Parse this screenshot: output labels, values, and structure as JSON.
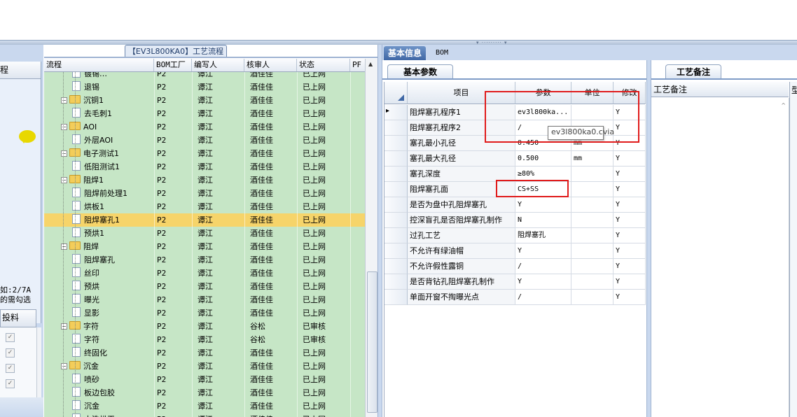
{
  "tree": {
    "title": "【EV3L800KA0】工艺流程",
    "columns": [
      "流程",
      "BOM工厂",
      "编写人",
      "核审人",
      "状态",
      "PF"
    ],
    "rows": [
      {
        "level": 2,
        "type": "doc",
        "name": "镀锡…",
        "bom": "P2",
        "writer": "谭江",
        "reviewer": "酒佳佳",
        "status": "已上网"
      },
      {
        "level": 2,
        "type": "doc",
        "name": "退锡",
        "bom": "P2",
        "writer": "谭江",
        "reviewer": "酒佳佳",
        "status": "已上网"
      },
      {
        "level": 1,
        "type": "folder",
        "name": "沉铜1",
        "bom": "P2",
        "writer": "谭江",
        "reviewer": "酒佳佳",
        "status": "已上网"
      },
      {
        "level": 2,
        "type": "doc",
        "name": "去毛刺1",
        "bom": "P2",
        "writer": "谭江",
        "reviewer": "酒佳佳",
        "status": "已上网"
      },
      {
        "level": 1,
        "type": "folder",
        "name": "AOI",
        "bom": "P2",
        "writer": "谭江",
        "reviewer": "酒佳佳",
        "status": "已上网"
      },
      {
        "level": 2,
        "type": "doc",
        "name": "外层AOI",
        "bom": "P2",
        "writer": "谭江",
        "reviewer": "酒佳佳",
        "status": "已上网"
      },
      {
        "level": 1,
        "type": "folder",
        "name": "电子测试1",
        "bom": "P2",
        "writer": "谭江",
        "reviewer": "酒佳佳",
        "status": "已上网"
      },
      {
        "level": 2,
        "type": "doc",
        "name": "低阻测试1",
        "bom": "P2",
        "writer": "谭江",
        "reviewer": "酒佳佳",
        "status": "已上网"
      },
      {
        "level": 1,
        "type": "folder",
        "name": "阻焊1",
        "bom": "P2",
        "writer": "谭江",
        "reviewer": "酒佳佳",
        "status": "已上网"
      },
      {
        "level": 2,
        "type": "doc",
        "name": "阻焊前处理1",
        "bom": "P2",
        "writer": "谭江",
        "reviewer": "酒佳佳",
        "status": "已上网"
      },
      {
        "level": 2,
        "type": "doc",
        "name": "烘板1",
        "bom": "P2",
        "writer": "谭江",
        "reviewer": "酒佳佳",
        "status": "已上网"
      },
      {
        "level": 2,
        "type": "doc",
        "name": "阻焊塞孔1",
        "bom": "P2",
        "writer": "谭江",
        "reviewer": "酒佳佳",
        "status": "已上网",
        "selected": true
      },
      {
        "level": 2,
        "type": "doc",
        "name": "预烘1",
        "bom": "P2",
        "writer": "谭江",
        "reviewer": "酒佳佳",
        "status": "已上网"
      },
      {
        "level": 1,
        "type": "folder",
        "name": "阻焊",
        "bom": "P2",
        "writer": "谭江",
        "reviewer": "酒佳佳",
        "status": "已上网"
      },
      {
        "level": 2,
        "type": "doc",
        "name": "阻焊塞孔",
        "bom": "P2",
        "writer": "谭江",
        "reviewer": "酒佳佳",
        "status": "已上网"
      },
      {
        "level": 2,
        "type": "doc",
        "name": "丝印",
        "bom": "P2",
        "writer": "谭江",
        "reviewer": "酒佳佳",
        "status": "已上网"
      },
      {
        "level": 2,
        "type": "doc",
        "name": "预烘",
        "bom": "P2",
        "writer": "谭江",
        "reviewer": "酒佳佳",
        "status": "已上网"
      },
      {
        "level": 2,
        "type": "doc",
        "name": "曝光",
        "bom": "P2",
        "writer": "谭江",
        "reviewer": "酒佳佳",
        "status": "已上网"
      },
      {
        "level": 2,
        "type": "doc",
        "name": "显影",
        "bom": "P2",
        "writer": "谭江",
        "reviewer": "酒佳佳",
        "status": "已上网"
      },
      {
        "level": 1,
        "type": "folder",
        "name": "字符",
        "bom": "P2",
        "writer": "谭江",
        "reviewer": "谷松",
        "status": "已审核"
      },
      {
        "level": 2,
        "type": "doc",
        "name": "字符",
        "bom": "P2",
        "writer": "谭江",
        "reviewer": "谷松",
        "status": "已审核"
      },
      {
        "level": 2,
        "type": "doc",
        "name": "终固化",
        "bom": "P2",
        "writer": "谭江",
        "reviewer": "酒佳佳",
        "status": "已上网"
      },
      {
        "level": 1,
        "type": "folder",
        "name": "沉金",
        "bom": "P2",
        "writer": "谭江",
        "reviewer": "酒佳佳",
        "status": "已上网"
      },
      {
        "level": 2,
        "type": "doc",
        "name": "喷砂",
        "bom": "P2",
        "writer": "谭江",
        "reviewer": "酒佳佳",
        "status": "已上网"
      },
      {
        "level": 2,
        "type": "doc",
        "name": "板边包胶",
        "bom": "P2",
        "writer": "谭江",
        "reviewer": "酒佳佳",
        "status": "已上网"
      },
      {
        "level": 2,
        "type": "doc",
        "name": "沉金",
        "bom": "P2",
        "writer": "谭江",
        "reviewer": "酒佳佳",
        "status": "已上网"
      },
      {
        "level": 2,
        "type": "doc",
        "name": "水洗烘干",
        "bom": "P2",
        "writer": "谭江",
        "reviewer": "酒佳佳",
        "status": "已上网"
      }
    ]
  },
  "left_panel": {
    "label_a": "程",
    "count_text": "如:2/7A",
    "hint_text": "的需勾选",
    "feed_header": "投料",
    "checks": [
      "✓",
      "✓",
      "✓",
      "✓"
    ]
  },
  "right": {
    "tabs": [
      "基本信息",
      "BOM"
    ],
    "subtab": "基本参数",
    "columns": [
      "项目",
      "参数",
      "单位",
      "修改"
    ],
    "params": [
      {
        "item": "阻焊塞孔程序1",
        "value": "ev3l800ka...",
        "unit": "",
        "modify": "Y",
        "current": true
      },
      {
        "item": "阻焊塞孔程序2",
        "value": "/",
        "unit": "",
        "modify": "Y"
      },
      {
        "item": "塞孔最小孔径",
        "value": "0.450",
        "unit": "mm",
        "modify": "Y"
      },
      {
        "item": "塞孔最大孔径",
        "value": "0.500",
        "unit": "mm",
        "modify": "Y"
      },
      {
        "item": "塞孔深度",
        "value": "≥80%",
        "unit": "",
        "modify": "Y"
      },
      {
        "item": "阻焊塞孔面",
        "value": "CS+SS",
        "unit": "",
        "modify": "Y"
      },
      {
        "item": "是否为盘中孔阻焊塞孔",
        "value": "Y",
        "unit": "",
        "modify": "Y"
      },
      {
        "item": "控深盲孔是否阻焊塞孔制作",
        "value": "N",
        "unit": "",
        "modify": "Y"
      },
      {
        "item": "过孔工艺",
        "value": "阻焊塞孔",
        "unit": "",
        "modify": "Y"
      },
      {
        "item": "不允许有绿油帽",
        "value": "Y",
        "unit": "",
        "modify": "Y"
      },
      {
        "item": "不允许假性露铜",
        "value": "/",
        "unit": "",
        "modify": "Y"
      },
      {
        "item": "是否背钻孔阻焊塞孔制作",
        "value": "Y",
        "unit": "",
        "modify": "Y"
      },
      {
        "item": "单面开窗不掏曝光点",
        "value": "/",
        "unit": "",
        "modify": "Y"
      }
    ],
    "tooltip": "ev3l800ka0.cvia",
    "notes_tab": "工艺备注",
    "notes_header": "工艺备注",
    "notes_cut": "型"
  },
  "colors": {
    "highlight_box": "#e01b1b",
    "tree_bg": "#c6e6c6",
    "selected_row": "#f6d46a",
    "tab_active": "#3f67a5"
  }
}
